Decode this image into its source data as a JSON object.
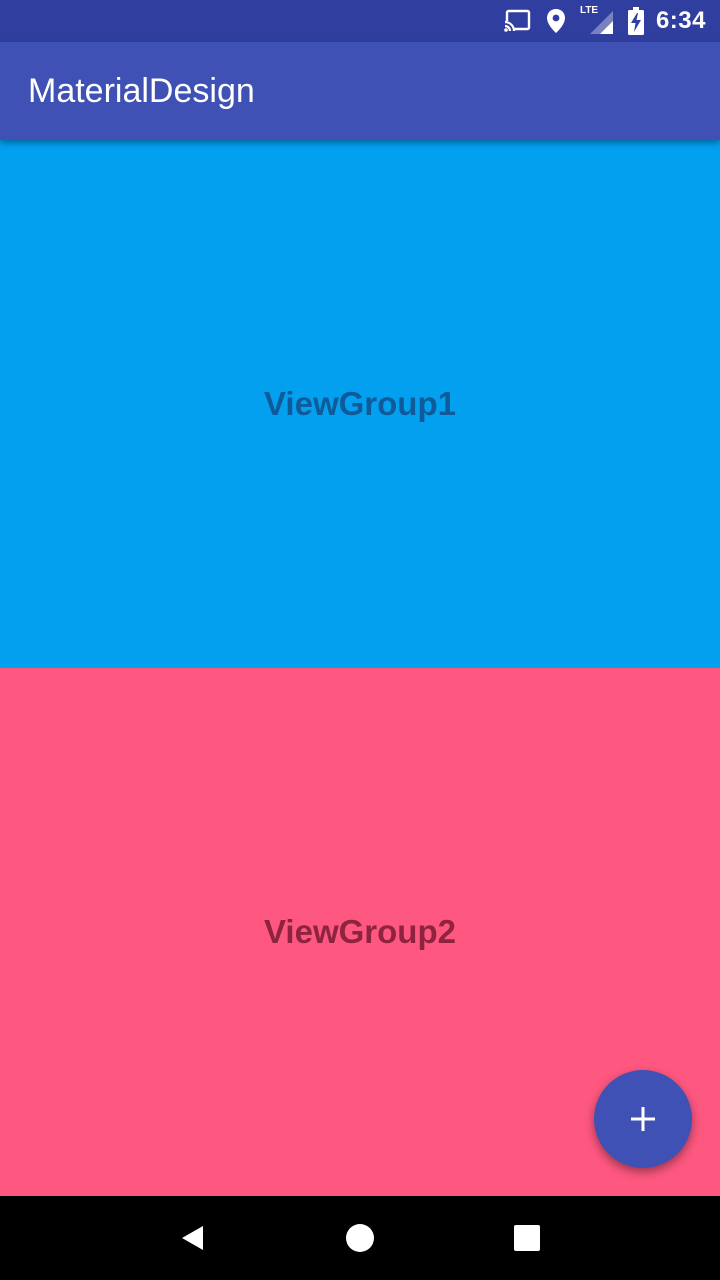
{
  "status_bar": {
    "time": "6:34",
    "network_label": "LTE",
    "icons": [
      "cast-icon",
      "location-icon",
      "signal-icon",
      "battery-charging-icon"
    ]
  },
  "app_bar": {
    "title": "MaterialDesign"
  },
  "content": {
    "group1": {
      "label": "ViewGroup1",
      "background": "#03A0F0",
      "text_color": "#0F5A98"
    },
    "group2": {
      "label": "ViewGroup2",
      "background": "#FF5880",
      "text_color": "#8E2340"
    }
  },
  "fab": {
    "icon": "plus-icon",
    "color": "#3F51B5"
  },
  "nav_bar": {
    "buttons": [
      "back-icon",
      "home-icon",
      "recents-icon"
    ]
  },
  "colors": {
    "primary": "#3F51B5",
    "primary_dark": "#303F9F"
  }
}
